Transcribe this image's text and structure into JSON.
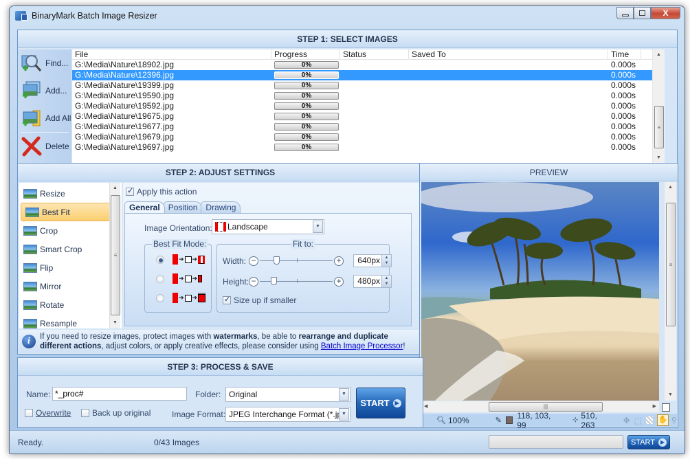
{
  "window": {
    "title": "BinaryMark Batch Image Resizer",
    "minimize": "–",
    "maximize": "□",
    "close": "X"
  },
  "step1": {
    "title": "STEP 1: SELECT IMAGES",
    "tools": [
      {
        "label": "Find...",
        "icon": "find-images-icon"
      },
      {
        "label": "Add...",
        "icon": "add-images-icon"
      },
      {
        "label": "Add All",
        "icon": "add-folder-icon"
      },
      {
        "label": "Delete",
        "icon": "delete-icon"
      }
    ],
    "columns": [
      "File",
      "Progress",
      "Status",
      "Saved To",
      "Time"
    ],
    "rows": [
      {
        "file": "G:\\Media\\Nature\\18902.jpg",
        "progress": "0%",
        "status": "",
        "saved_to": "",
        "time": "0.000s",
        "selected": false
      },
      {
        "file": "G:\\Media\\Nature\\12396.jpg",
        "progress": "0%",
        "status": "",
        "saved_to": "",
        "time": "0.000s",
        "selected": true
      },
      {
        "file": "G:\\Media\\Nature\\19399.jpg",
        "progress": "0%",
        "status": "",
        "saved_to": "",
        "time": "0.000s",
        "selected": false
      },
      {
        "file": "G:\\Media\\Nature\\19590.jpg",
        "progress": "0%",
        "status": "",
        "saved_to": "",
        "time": "0.000s",
        "selected": false
      },
      {
        "file": "G:\\Media\\Nature\\19592.jpg",
        "progress": "0%",
        "status": "",
        "saved_to": "",
        "time": "0.000s",
        "selected": false
      },
      {
        "file": "G:\\Media\\Nature\\19675.jpg",
        "progress": "0%",
        "status": "",
        "saved_to": "",
        "time": "0.000s",
        "selected": false
      },
      {
        "file": "G:\\Media\\Nature\\19677.jpg",
        "progress": "0%",
        "status": "",
        "saved_to": "",
        "time": "0.000s",
        "selected": false
      },
      {
        "file": "G:\\Media\\Nature\\19679.jpg",
        "progress": "0%",
        "status": "",
        "saved_to": "",
        "time": "0.000s",
        "selected": false
      },
      {
        "file": "G:\\Media\\Nature\\19697.jpg",
        "progress": "0%",
        "status": "",
        "saved_to": "",
        "time": "0.000s",
        "selected": false
      }
    ]
  },
  "step2": {
    "title": "STEP 2: ADJUST SETTINGS",
    "actions": [
      {
        "label": "Resize",
        "selected": false
      },
      {
        "label": "Best Fit",
        "selected": true
      },
      {
        "label": "Crop",
        "selected": false
      },
      {
        "label": "Smart Crop",
        "selected": false
      },
      {
        "label": "Flip",
        "selected": false
      },
      {
        "label": "Mirror",
        "selected": false
      },
      {
        "label": "Rotate",
        "selected": false
      },
      {
        "label": "Resample",
        "selected": false
      }
    ],
    "apply_label": "Apply this action",
    "apply_checked": true,
    "tabs": [
      "General",
      "Position",
      "Drawing"
    ],
    "active_tab": "General",
    "orientation_label": "Image Orientation:",
    "orientation_value": "Landscape",
    "best_fit_mode_label": "Best Fit Mode:",
    "best_fit_mode_selected": 0,
    "fit_to_label": "Fit to:",
    "width_label": "Width:",
    "width_value": "640px",
    "height_label": "Height:",
    "height_value": "480px",
    "size_up_label": "Size up if smaller",
    "size_up_checked": true,
    "info": {
      "t1": "If you need to resize images, protect images with ",
      "b1": "watermarks",
      "t2": ", be able to ",
      "b2": "rearrange and duplicate different actions",
      "t3": ", adjust colors, or apply creative effects, please consider using ",
      "link": "Batch Image Processor",
      "t4": "!"
    }
  },
  "preview": {
    "title": "PREVIEW",
    "zoom": "100%",
    "color_value": "118, 103, 99",
    "color_swatch": "#766763",
    "coords": "510, 263"
  },
  "step3": {
    "title": "STEP 3: PROCESS & SAVE",
    "name_label": "Name:",
    "name_value": "*_proc#",
    "folder_label": "Folder:",
    "folder_value": "Original",
    "format_label": "Image Format:",
    "format_value": "JPEG Interchange Format (*.jpg,",
    "overwrite_label": "Overwrite",
    "backup_label": "Back up original",
    "start_label": "START"
  },
  "statusbar": {
    "status": "Ready.",
    "count": "0/43 Images",
    "start_label": "START"
  }
}
